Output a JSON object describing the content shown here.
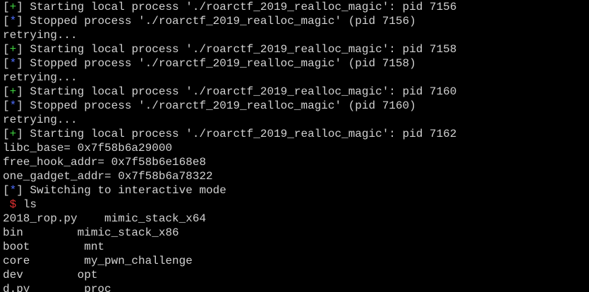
{
  "colors": {
    "background": "#000000",
    "text": "#d2d2d2",
    "plus_marker": "#3fcf3f",
    "star_marker": "#4f6fff",
    "prompt_dollar": "#e03030"
  },
  "terminal": {
    "lines": [
      {
        "marker": "+",
        "text": "Starting local process './roarctf_2019_realloc_magic': pid 7156"
      },
      {
        "marker": "*",
        "text": "Stopped process './roarctf_2019_realloc_magic' (pid 7156)"
      },
      {
        "marker": "",
        "text": "retrying..."
      },
      {
        "marker": "+",
        "text": "Starting local process './roarctf_2019_realloc_magic': pid 7158"
      },
      {
        "marker": "*",
        "text": "Stopped process './roarctf_2019_realloc_magic' (pid 7158)"
      },
      {
        "marker": "",
        "text": "retrying..."
      },
      {
        "marker": "+",
        "text": "Starting local process './roarctf_2019_realloc_magic': pid 7160"
      },
      {
        "marker": "*",
        "text": "Stopped process './roarctf_2019_realloc_magic' (pid 7160)"
      },
      {
        "marker": "",
        "text": "retrying..."
      },
      {
        "marker": "+",
        "text": "Starting local process './roarctf_2019_realloc_magic': pid 7162"
      },
      {
        "marker": "",
        "text": "libc_base= 0x7f58b6a29000"
      },
      {
        "marker": "",
        "text": "free_hook_addr= 0x7f58b6e168e8"
      },
      {
        "marker": "",
        "text": "one_gadget_addr= 0x7f58b6a78322"
      },
      {
        "marker": "*",
        "text": "Switching to interactive mode"
      }
    ],
    "prompt": {
      "symbol": "$",
      "command": "ls"
    },
    "listing": [
      "2018_rop.py    mimic_stack_x64",
      "bin        mimic_stack_x86",
      "boot        mnt",
      "core        my_pwn_challenge",
      "dev        opt",
      "d.py        proc"
    ]
  }
}
